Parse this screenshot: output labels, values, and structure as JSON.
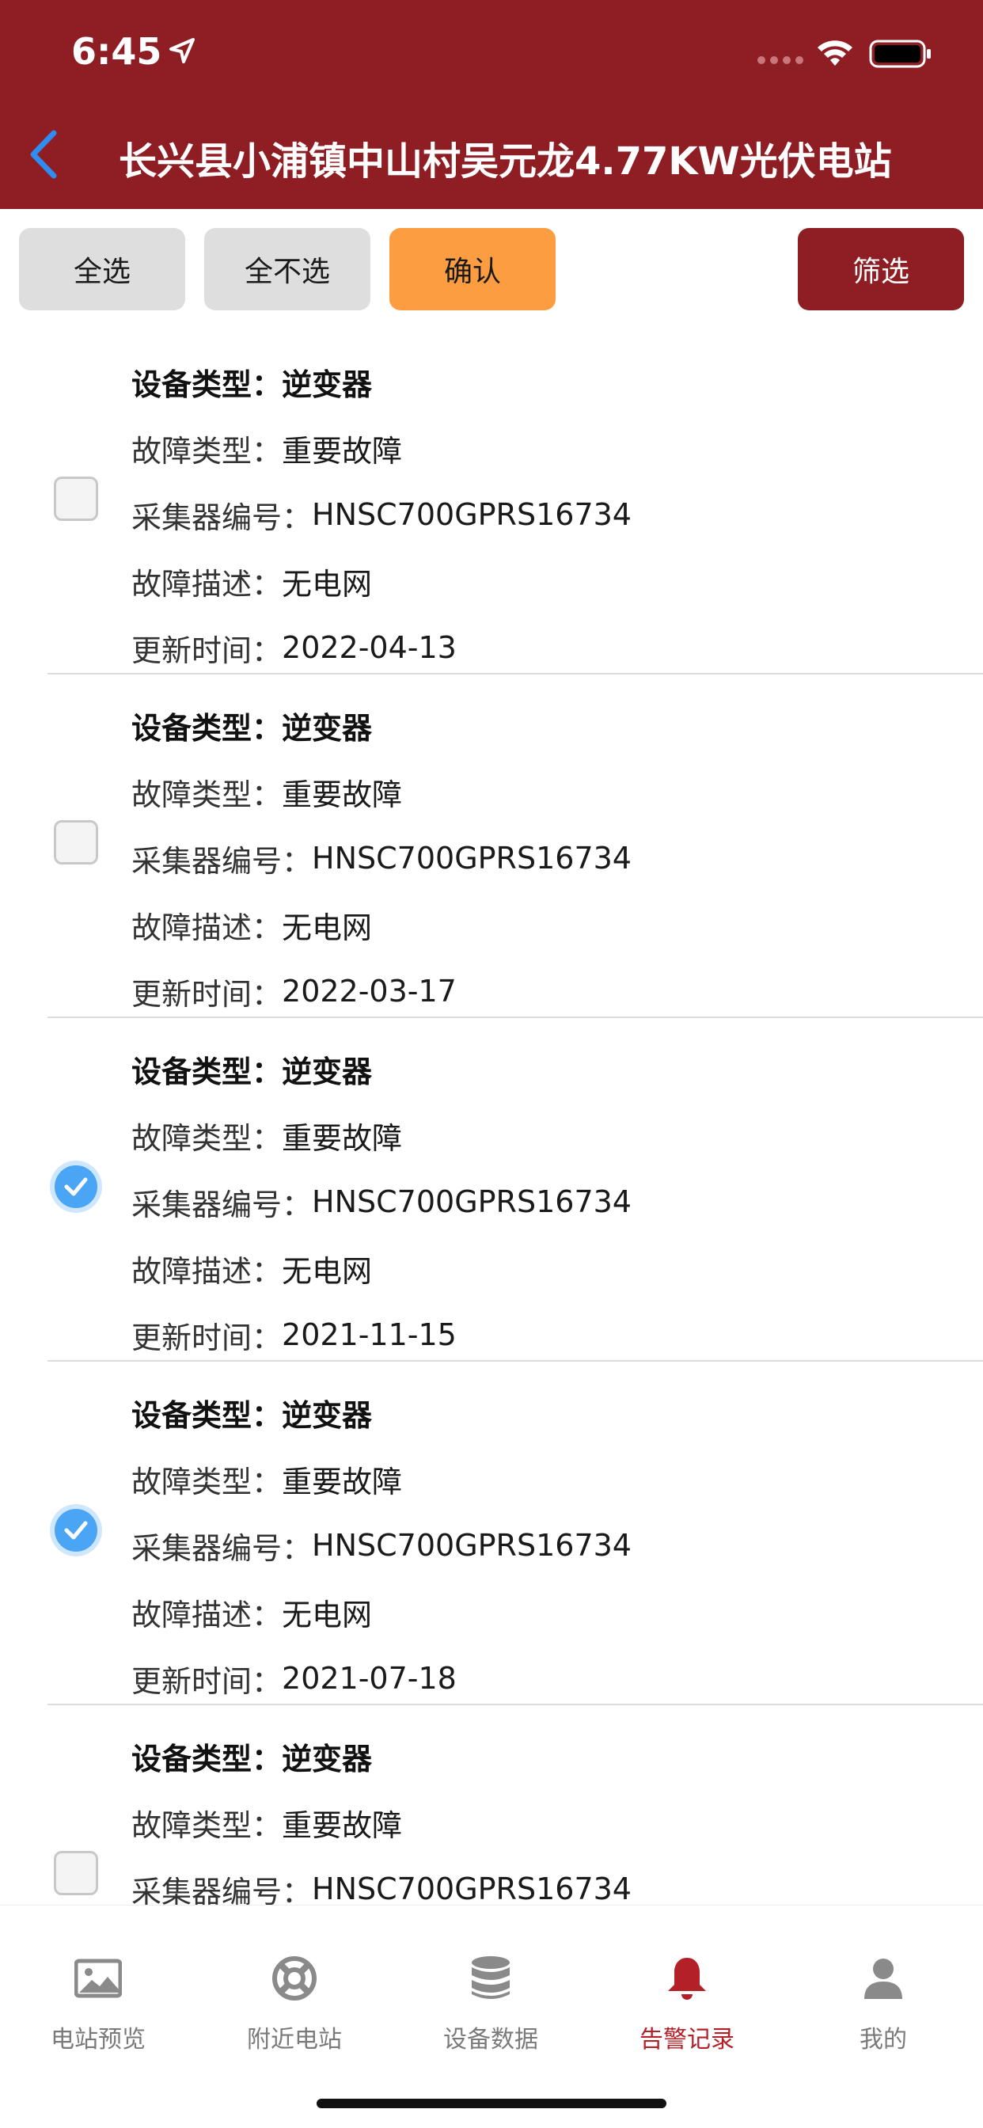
{
  "status_bar": {
    "time": "6:45"
  },
  "header": {
    "title": "长兴县小浦镇中山村吴元龙4.77KW光伏电站"
  },
  "toolbar": {
    "select_all": "全选",
    "select_none": "全不选",
    "confirm": "确认",
    "filter": "筛选"
  },
  "labels": {
    "device_type": "设备类型：",
    "fault_type": "故障类型：",
    "collector_no": "采集器编号：",
    "fault_desc": "故障描述：",
    "update_time": "更新时间："
  },
  "alarms": [
    {
      "device_type": "逆变器",
      "fault_type": "重要故障",
      "collector_no": "HNSC700GPRS16734",
      "fault_desc": "无电网",
      "update_time": "2022-04-13",
      "checked": false
    },
    {
      "device_type": "逆变器",
      "fault_type": "重要故障",
      "collector_no": "HNSC700GPRS16734",
      "fault_desc": "无电网",
      "update_time": "2022-03-17",
      "checked": false
    },
    {
      "device_type": "逆变器",
      "fault_type": "重要故障",
      "collector_no": "HNSC700GPRS16734",
      "fault_desc": "无电网",
      "update_time": "2021-11-15",
      "checked": true
    },
    {
      "device_type": "逆变器",
      "fault_type": "重要故障",
      "collector_no": "HNSC700GPRS16734",
      "fault_desc": "无电网",
      "update_time": "2021-07-18",
      "checked": true
    },
    {
      "device_type": "逆变器",
      "fault_type": "重要故障",
      "collector_no": "HNSC700GPRS16734",
      "fault_desc": "",
      "update_time": "",
      "checked": false
    }
  ],
  "tabs": [
    {
      "label": "电站预览",
      "icon": "image-icon",
      "active": false
    },
    {
      "label": "附近电站",
      "icon": "lifebuoy-icon",
      "active": false
    },
    {
      "label": "设备数据",
      "icon": "database-icon",
      "active": false
    },
    {
      "label": "告警记录",
      "icon": "bell-icon",
      "active": true
    },
    {
      "label": "我的",
      "icon": "user-icon",
      "active": false
    }
  ],
  "colors": {
    "brand": "#8f1e24",
    "confirm": "#fd9d41",
    "active_tab": "#b32028",
    "check": "#4aa6f5"
  }
}
